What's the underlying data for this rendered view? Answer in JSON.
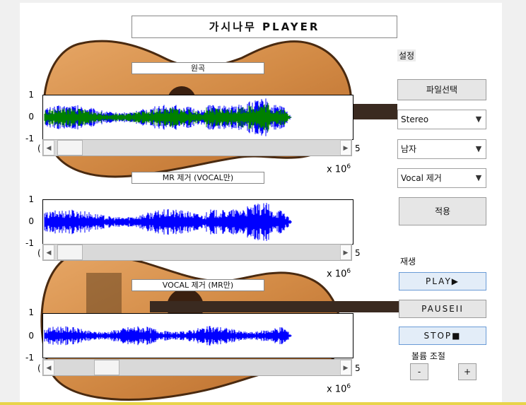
{
  "app": {
    "title": "가시나무 PLAYER"
  },
  "panels": [
    {
      "label": "원곡",
      "yticks": [
        "1",
        "0",
        "-1"
      ],
      "x_exponent_base": "x 10",
      "x_exponent_power": "6",
      "x_end_tick": "5",
      "tick_start_fragment": "(",
      "wave_colors": [
        "#0000ff",
        "#008000"
      ]
    },
    {
      "label": "MR 제거 (VOCAL만)",
      "yticks": [
        "1",
        "0",
        "-1"
      ],
      "x_exponent_base": "x 10",
      "x_exponent_power": "6",
      "x_end_tick": "5",
      "tick_start_fragment": "(",
      "wave_colors": [
        "#0000ff"
      ]
    },
    {
      "label": "VOCAL 제거 (MR만)",
      "yticks": [
        "1",
        "0",
        "-1"
      ],
      "x_exponent_base": "x 10",
      "x_exponent_power": "6",
      "x_end_tick": "5",
      "tick_start_fragment": "(",
      "wave_colors": [
        "#0000ff"
      ]
    }
  ],
  "settings": {
    "section_label": "설정",
    "file_button": "파일선택",
    "channel_select": "Stereo",
    "gender_select": "남자",
    "mode_select": "Vocal 제거",
    "apply_button": "적용"
  },
  "playback": {
    "section_label": "재생",
    "play_button": "PLAY▶",
    "pause_button": "PAUSEII",
    "stop_button": "STOP■",
    "volume_label": "볼륨 조절",
    "volume_down": "-",
    "volume_up": "+"
  },
  "icons": {
    "slider_left": "triangle-left-icon",
    "slider_right": "triangle-right-icon",
    "dropdown": "chevron-down-icon"
  },
  "colors": {
    "accent_blue": "#0000ff",
    "accent_green": "#008000",
    "guitar_wood": "#d9914a"
  }
}
